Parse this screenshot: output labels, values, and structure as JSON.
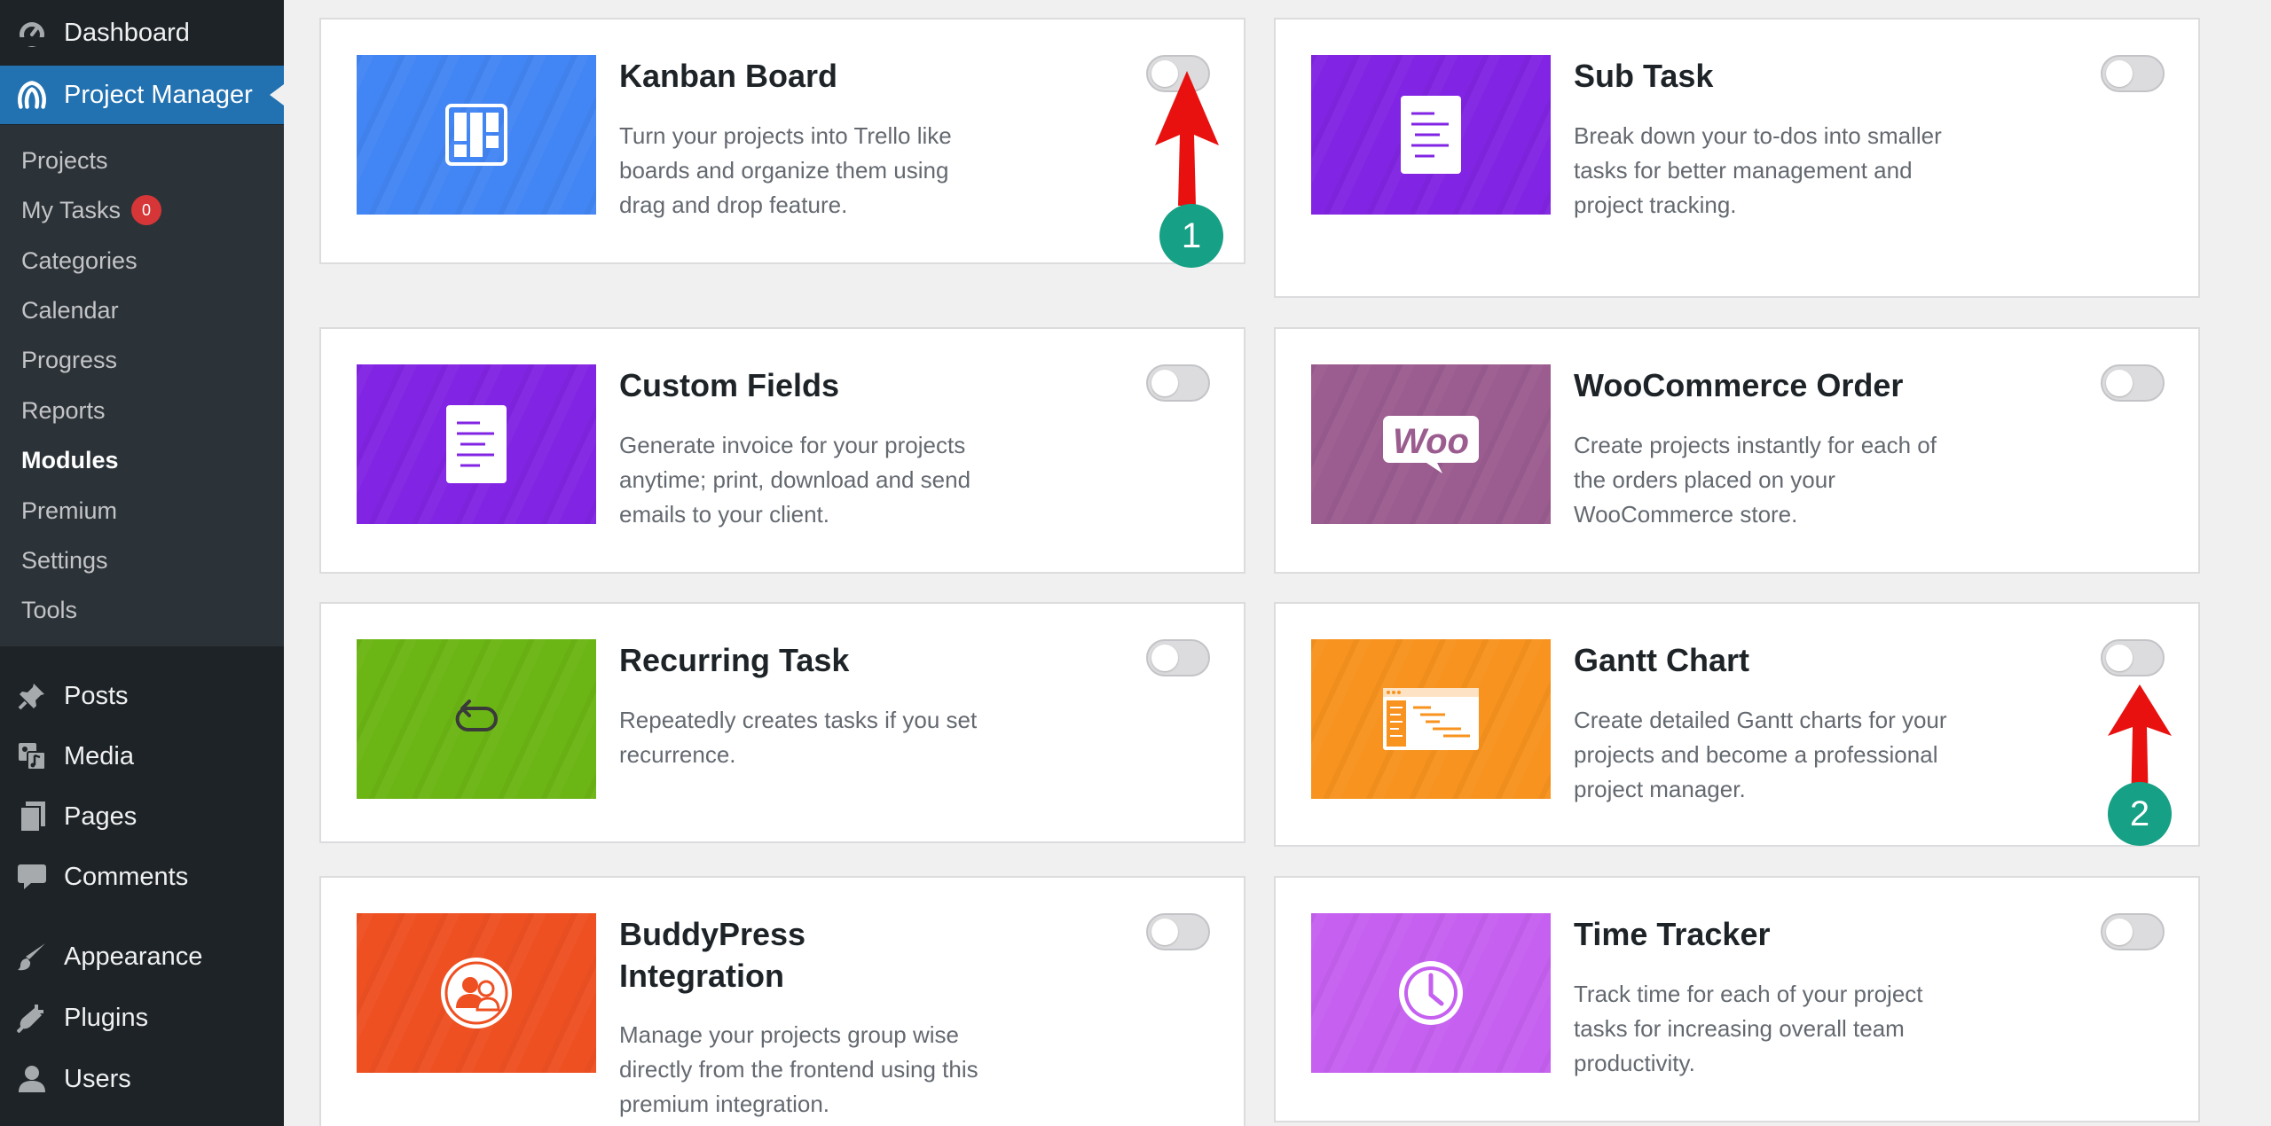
{
  "sidebar": {
    "top_items": [
      {
        "label": "Dashboard",
        "icon": "dashboard-icon"
      },
      {
        "label": "Project Manager",
        "icon": "project-manager-logo-icon"
      }
    ],
    "submenu": [
      {
        "label": "Projects"
      },
      {
        "label": "My Tasks",
        "badge": "0"
      },
      {
        "label": "Categories"
      },
      {
        "label": "Calendar"
      },
      {
        "label": "Progress"
      },
      {
        "label": "Reports"
      },
      {
        "label": "Modules",
        "current": true
      },
      {
        "label": "Premium"
      },
      {
        "label": "Settings"
      },
      {
        "label": "Tools"
      }
    ],
    "bottom_items": [
      {
        "label": "Posts",
        "icon": "pin-icon"
      },
      {
        "label": "Media",
        "icon": "media-icon"
      },
      {
        "label": "Pages",
        "icon": "pages-icon"
      },
      {
        "label": "Comments",
        "icon": "comment-icon"
      },
      {
        "label": "Appearance",
        "icon": "brush-icon"
      },
      {
        "label": "Plugins",
        "icon": "plug-icon"
      },
      {
        "label": "Users",
        "icon": "user-icon"
      }
    ]
  },
  "modules": [
    {
      "title": "Kanban Board",
      "description": "Turn your projects into Trello like boards and organize them using drag and drop feature.",
      "color": "#4285f4",
      "icon": "kanban-icon",
      "enabled": false
    },
    {
      "title": "Sub Task",
      "description": "Break down your to-dos into smaller tasks for better management and project tracking.",
      "color": "#8224e3",
      "icon": "document-icon",
      "enabled": false
    },
    {
      "title": "Custom Fields",
      "description": "Generate invoice for your projects anytime; print, download and send emails to your client.",
      "color": "#8224e3",
      "icon": "document-icon",
      "enabled": false
    },
    {
      "title": "WooCommerce Order",
      "description": "Create projects instantly for each of the orders placed on your WooCommerce store.",
      "color": "#9b5c8f",
      "icon": "woo-logo-icon",
      "logo_text": "Woo",
      "enabled": false
    },
    {
      "title": "Recurring Task",
      "description": "Repeatedly creates tasks if you set recurrence.",
      "color": "#6bb514",
      "icon": "recurring-icon",
      "enabled": false
    },
    {
      "title": "Gantt Chart",
      "description": "Create detailed Gantt charts for your projects and become a professional project manager.",
      "color": "#f7931e",
      "icon": "gantt-chart-icon",
      "enabled": false
    },
    {
      "title": "BuddyPress Integration",
      "description": "Manage your projects group wise directly from the frontend using this premium integration.",
      "color": "#ee5022",
      "icon": "group-users-icon",
      "enabled": false
    },
    {
      "title": "Time Tracker",
      "description": "Track time for each of your project tasks for increasing overall team productivity.",
      "color": "#c560f0",
      "icon": "clock-icon",
      "enabled": false
    }
  ],
  "annotations": [
    {
      "number": "1",
      "color": "#16a085",
      "arrow_color": "#e8110f"
    },
    {
      "number": "2",
      "color": "#16a085",
      "arrow_color": "#e8110f"
    }
  ]
}
